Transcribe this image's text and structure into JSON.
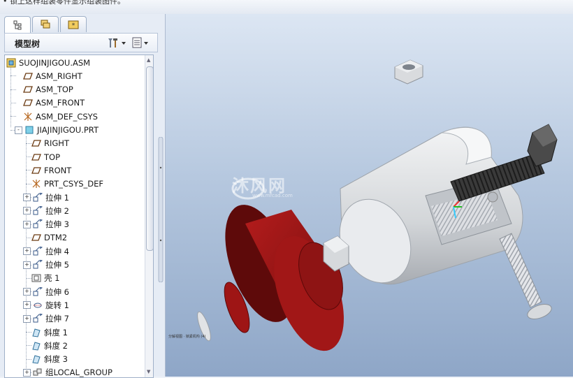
{
  "top_text": "• 锁上这样组装零件显示组装图件。",
  "left_panel": {
    "tabs": [
      "model-tree-tab",
      "layers-tab",
      "favorites-tab"
    ],
    "header_label": "模型树",
    "tree_items": [
      {
        "label": "SUOJINJIGOU.ASM",
        "icon": "assembly-icon",
        "level": 0
      },
      {
        "label": "ASM_RIGHT",
        "icon": "datum-plane-icon",
        "level": 1
      },
      {
        "label": "ASM_TOP",
        "icon": "datum-plane-icon",
        "level": 1
      },
      {
        "label": "ASM_FRONT",
        "icon": "datum-plane-icon",
        "level": 1
      },
      {
        "label": "ASM_DEF_CSYS",
        "icon": "csys-icon",
        "level": 1
      },
      {
        "label": "JIAJINJIGOU.PRT",
        "icon": "part-icon",
        "level": 1,
        "expander": "-"
      },
      {
        "label": "RIGHT",
        "icon": "datum-plane-icon",
        "level": 2
      },
      {
        "label": "TOP",
        "icon": "datum-plane-icon",
        "level": 2
      },
      {
        "label": "FRONT",
        "icon": "datum-plane-icon",
        "level": 2
      },
      {
        "label": "PRT_CSYS_DEF",
        "icon": "csys-icon",
        "level": 2
      },
      {
        "label": "拉伸 1",
        "icon": "extrude-icon",
        "level": 2,
        "expander": "+"
      },
      {
        "label": "拉伸 2",
        "icon": "extrude-icon",
        "level": 2,
        "expander": "+"
      },
      {
        "label": "拉伸 3",
        "icon": "extrude-icon",
        "level": 2,
        "expander": "+"
      },
      {
        "label": "DTM2",
        "icon": "datum-plane-icon",
        "level": 2
      },
      {
        "label": "拉伸 4",
        "icon": "extrude-icon",
        "level": 2,
        "expander": "+"
      },
      {
        "label": "拉伸 5",
        "icon": "extrude-icon",
        "level": 2,
        "expander": "+"
      },
      {
        "label": "壳 1",
        "icon": "shell-icon",
        "level": 2
      },
      {
        "label": "拉伸 6",
        "icon": "extrude-icon",
        "level": 2,
        "expander": "+"
      },
      {
        "label": "旋转 1",
        "icon": "revolve-icon",
        "level": 2,
        "expander": "+"
      },
      {
        "label": "拉伸 7",
        "icon": "extrude-icon",
        "level": 2,
        "expander": "+"
      },
      {
        "label": "斜度 1",
        "icon": "draft-icon",
        "level": 2
      },
      {
        "label": "斜度 2",
        "icon": "draft-icon",
        "level": 2
      },
      {
        "label": "斜度 3",
        "icon": "draft-icon",
        "level": 2
      },
      {
        "label": "组LOCAL_GROUP",
        "icon": "group-icon",
        "level": 2,
        "expander": "+"
      }
    ]
  },
  "viewport": {
    "watermark": "沐风网",
    "watermark_sub": "www.mfcad.com",
    "status_note": "分解视图 · 锁紧机构 (4)"
  },
  "colors": {
    "red_part": "#8e1414",
    "grey_part": "#d4d6d9",
    "bolt": "#2f2f2f"
  }
}
